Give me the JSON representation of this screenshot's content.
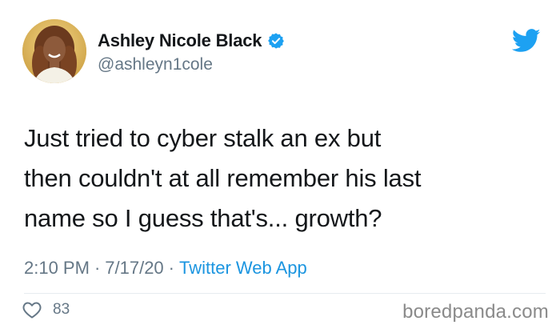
{
  "author": {
    "display_name": "Ashley Nicole Black",
    "handle": "@ashleyn1cole",
    "verified": true,
    "avatar_icon": "avatar"
  },
  "tweet": {
    "lines": [
      "Just tried to cyber stalk an ex but",
      "then couldn't at all remember his last",
      "name so I guess that's... growth?"
    ],
    "time": "2:10 PM",
    "date": "7/17/20",
    "separator": "·",
    "source": "Twitter Web App"
  },
  "actions": {
    "likes_count": "83",
    "like_icon": "heart-icon"
  },
  "brand": {
    "logo_icon": "twitter-bird-icon",
    "accent": "#1da1f2"
  },
  "watermark": {
    "text": "boredpanda.com"
  }
}
